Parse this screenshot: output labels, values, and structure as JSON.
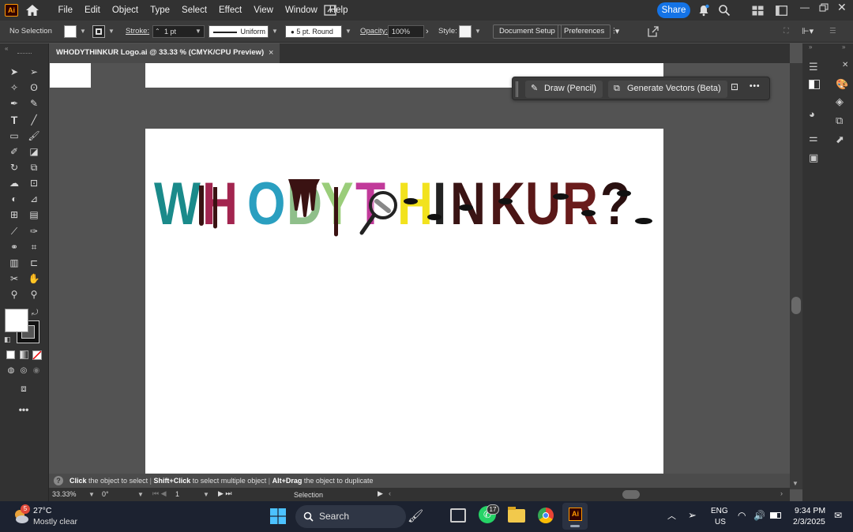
{
  "app": {
    "logo_text": "Ai",
    "accent": "#ff9a00"
  },
  "menu": {
    "items": [
      "File",
      "Edit",
      "Object",
      "Type",
      "Select",
      "Effect",
      "View",
      "Window",
      "Help"
    ]
  },
  "share": {
    "label": "Share",
    "color": "#1473e6"
  },
  "control_bar": {
    "selection": "No Selection",
    "stroke_label": "Stroke:",
    "stroke_value": "1 pt",
    "stroke_profile": "Uniform",
    "brush": "5 pt. Round",
    "opacity_label": "Opacity:",
    "opacity_value": "100%",
    "style_label": "Style:",
    "document_setup": "Document Setup",
    "preferences": "Preferences"
  },
  "document_tab": {
    "title": "WHODYTHINKUR Logo.ai @ 33.33 % (CMYK/CPU Preview)",
    "close": "×"
  },
  "contextual_bar": {
    "draw": "Draw (Pencil)",
    "generate": "Generate Vectors (Beta)",
    "more": "•••"
  },
  "logo": {
    "text": "WHODYTHINKUR?",
    "letters": [
      {
        "ch": "W",
        "color": "#1a8a8a"
      },
      {
        "ch": "H",
        "color": "#a2254f"
      },
      {
        "ch": "O",
        "color": "#2a9fc0"
      },
      {
        "ch": "D",
        "color": "#8fbf8a"
      },
      {
        "ch": "Y",
        "color": "#9acd7a"
      },
      {
        "ch": "T",
        "color": "#c13a9a"
      },
      {
        "ch": "H",
        "color": "#f2e21e"
      },
      {
        "ch": "I",
        "color": "#222222"
      },
      {
        "ch": "N",
        "color": "#3a1414"
      },
      {
        "ch": "K",
        "color": "#4a1616"
      },
      {
        "ch": "U",
        "color": "#5a1818"
      },
      {
        "ch": "R",
        "color": "#6a1c1c"
      },
      {
        "ch": "?",
        "color": "#2a1010"
      }
    ]
  },
  "hint": {
    "a_key": "Click",
    "a_text": "the object to select",
    "b_key": "Shift+Click",
    "b_text": "to select multiple object",
    "c_key": "Alt+Drag",
    "c_text": "the object to duplicate"
  },
  "status": {
    "zoom": "33.33%",
    "rotation": "0°",
    "artboard": "1",
    "tool": "Selection"
  },
  "taskbar": {
    "weather_temp": "27°C",
    "weather_desc": "Mostly clear",
    "weather_badge": "5",
    "search": "Search",
    "whatsapp_badge": "17",
    "lang": "ENG",
    "region": "US",
    "time": "9:34 PM",
    "date": "2/3/2025"
  }
}
